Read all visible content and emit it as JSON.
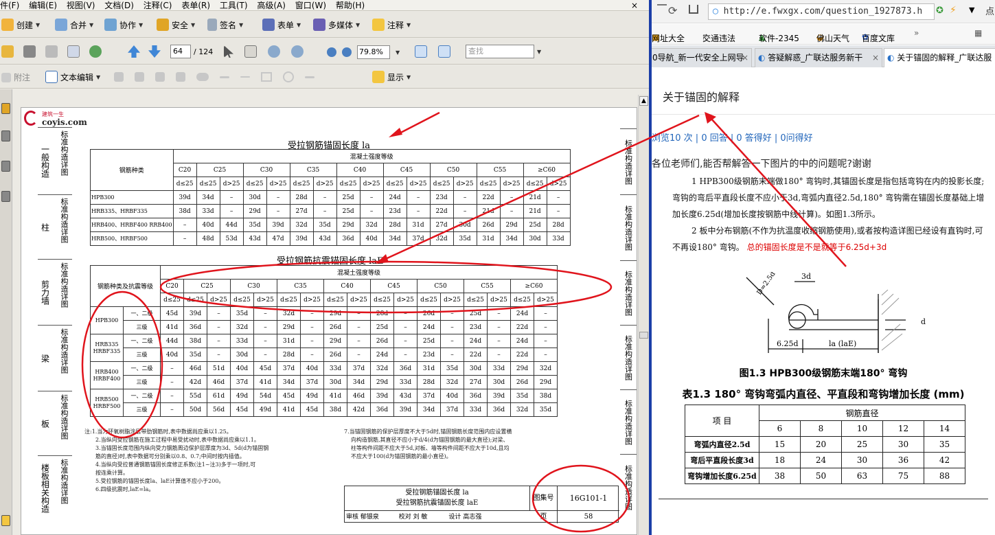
{
  "pdf_viewer": {
    "menu": [
      "件(F)",
      "编辑(E)",
      "视图(V)",
      "文档(D)",
      "注释(C)",
      "表单(R)",
      "工具(T)",
      "高级(A)",
      "窗口(W)",
      "帮助(H)"
    ],
    "close_glyph": "×",
    "toolbar1": {
      "create": "创建",
      "combine": "合并",
      "collaborate": "协作",
      "secure": "安全",
      "sign": "签名",
      "forms": "表单",
      "multimedia": "多媒体",
      "comment": "注释"
    },
    "toolbar2": {
      "page_current": "64",
      "page_total": "/ 124",
      "zoom": "79.8%",
      "find_placeholder": "查找"
    },
    "toolbar3": {
      "attach": "附注",
      "text_edit": "文本编辑",
      "show": "显示"
    },
    "document": {
      "logo_small": "建筑一生",
      "logo_text": "coyis.com",
      "left_categories": [
        {
          "big": "一般构造",
          "small": "标准构造详图"
        },
        {
          "big": "柱",
          "small": "标准构造详图"
        },
        {
          "big": "剪力墙",
          "small": "标准构造详图"
        },
        {
          "big": "梁",
          "small": "标准构造详图"
        },
        {
          "big": "板",
          "small": "标准构造详图"
        },
        {
          "big": "楼板相关构造",
          "small": "标准构造详图"
        }
      ],
      "right_category": "标准构造详图",
      "table1_title": "受拉钢筋锚固长度 la",
      "table2_title": "受拉钢筋抗震锚固长度 laE",
      "concrete_header": "混凝土强度等级",
      "grades": [
        "C20",
        "C25",
        "C30",
        "C35",
        "C40",
        "C45",
        "C50",
        "C55",
        "≥C60"
      ],
      "sub_le": "d≤25",
      "sub_gt": "d>25",
      "table1_col0": "钢筋种类",
      "table1_rows": [
        {
          "type": "HPB300",
          "vals": [
            "39d",
            "34d",
            "–",
            "30d",
            "–",
            "28d",
            "–",
            "25d",
            "–",
            "24d",
            "–",
            "23d",
            "–",
            "22d",
            "–",
            "21d",
            "–"
          ]
        },
        {
          "type": "HRB335、HRBF335",
          "vals": [
            "38d",
            "33d",
            "–",
            "29d",
            "–",
            "27d",
            "–",
            "25d",
            "–",
            "23d",
            "–",
            "22d",
            "–",
            "21d",
            "–",
            "21d",
            "–"
          ]
        },
        {
          "type": "HRB400、HRBF400 RRB400",
          "vals": [
            "–",
            "40d",
            "44d",
            "35d",
            "39d",
            "32d",
            "35d",
            "29d",
            "32d",
            "28d",
            "31d",
            "27d",
            "30d",
            "26d",
            "29d",
            "25d",
            "28d"
          ]
        },
        {
          "type": "HRB500、HRBF500",
          "vals": [
            "–",
            "48d",
            "53d",
            "43d",
            "47d",
            "39d",
            "43d",
            "36d",
            "40d",
            "34d",
            "37d",
            "32d",
            "35d",
            "31d",
            "34d",
            "30d",
            "33d"
          ]
        }
      ],
      "table2_col0": "钢筋种类及抗震等级",
      "table2_rows": [
        {
          "type": "HPB300",
          "grade": "一、二级",
          "vals": [
            "45d",
            "39d",
            "–",
            "35d",
            "–",
            "32d",
            "–",
            "29d",
            "–",
            "28d",
            "–",
            "26d",
            "–",
            "25d",
            "–",
            "24d",
            "–"
          ]
        },
        {
          "type": "",
          "grade": "三级",
          "vals": [
            "41d",
            "36d",
            "–",
            "32d",
            "–",
            "29d",
            "–",
            "26d",
            "–",
            "25d",
            "–",
            "24d",
            "–",
            "23d",
            "–",
            "22d",
            "–"
          ]
        },
        {
          "type": "HRB335 HRBF335",
          "grade": "一、二级",
          "vals": [
            "44d",
            "38d",
            "–",
            "33d",
            "–",
            "31d",
            "–",
            "29d",
            "–",
            "26d",
            "–",
            "25d",
            "–",
            "24d",
            "–",
            "24d",
            "–"
          ]
        },
        {
          "type": "",
          "grade": "三级",
          "vals": [
            "40d",
            "35d",
            "–",
            "30d",
            "–",
            "28d",
            "–",
            "26d",
            "–",
            "24d",
            "–",
            "23d",
            "–",
            "22d",
            "–",
            "22d",
            "–"
          ]
        },
        {
          "type": "HRB400 HRBF400",
          "grade": "一、二级",
          "vals": [
            "–",
            "46d",
            "51d",
            "40d",
            "45d",
            "37d",
            "40d",
            "33d",
            "37d",
            "32d",
            "36d",
            "31d",
            "35d",
            "30d",
            "33d",
            "29d",
            "32d"
          ]
        },
        {
          "type": "",
          "grade": "三级",
          "vals": [
            "–",
            "42d",
            "46d",
            "37d",
            "41d",
            "34d",
            "37d",
            "30d",
            "34d",
            "29d",
            "33d",
            "28d",
            "32d",
            "27d",
            "30d",
            "26d",
            "29d"
          ]
        },
        {
          "type": "HRB500 HRBF500",
          "grade": "一、二级",
          "vals": [
            "–",
            "55d",
            "61d",
            "49d",
            "54d",
            "45d",
            "49d",
            "41d",
            "46d",
            "39d",
            "43d",
            "37d",
            "40d",
            "36d",
            "39d",
            "35d",
            "38d"
          ]
        },
        {
          "type": "",
          "grade": "三级",
          "vals": [
            "–",
            "50d",
            "56d",
            "45d",
            "49d",
            "41d",
            "45d",
            "38d",
            "42d",
            "36d",
            "39d",
            "34d",
            "37d",
            "33d",
            "36d",
            "32d",
            "35d"
          ]
        }
      ],
      "notes_left": [
        "注:1.当为环氧树脂涂层带肋钢筋时,表中数据尚应乘以1.25。",
        "2.当纵向受拉钢筋在施工过程中易受扰动时,表中数据尚应乘以1.1。",
        "3.当锚固长度范围内纵向受力钢筋周边保护层厚度为3d、5d(d为锚固钢",
        "筋的直径)时,表中数据可分别乘以0.8、0.7;中间时按内插值。",
        "4.当纵向受拉普通钢筋锚固长度修正系数(注1~注3)多于一项时,可",
        "按连乘计算。",
        "5.受拉钢筋的锚固长度la、laE计算值不应小于200。",
        "6.四级抗震时,laE=la。"
      ],
      "notes_right": [
        "7.当锚固钢筋的保护层厚度不大于5d时,锚固钢筋长度范围内应设置横",
        "向构造钢筋,其直径不应小于d/4(d为锚固钢筋的最大直径);对梁、",
        "柱等构件间距不应大于5d,对板、墙等构件间距不应大于10d,且均",
        "不应大于100(d为锚固钢筋的最小直径)。"
      ],
      "title_block": {
        "title1": "受拉钢筋锚固长度 la",
        "title2": "受拉钢筋抗震锚固长度 laE",
        "atlas_label": "图集号",
        "atlas_no": "16G101-1",
        "page_label": "页",
        "page_no": "58",
        "review": "审核",
        "reviewer": "郁银泉",
        "check": "校对",
        "checker": "刘 敏",
        "design": "设计",
        "designer": "高志强"
      }
    }
  },
  "browser": {
    "url": "http://e.fwxgx.com/question_1927873.h",
    "bookmarks": [
      "网址大全",
      "交通违法",
      "软件-2345",
      "佛山天气",
      "百度文库"
    ],
    "bm_more": "»",
    "tabs": [
      {
        "label": "0导航_新一代安全上网导"
      },
      {
        "label": "答疑解惑_广联达服务新干"
      },
      {
        "label": "关于锚固的解释_广联达服"
      }
    ],
    "tab_close": "×",
    "question_title": "关于锚固的解释",
    "stats": "浏览10 次 | 0 回答 | 0 答得好 | 0问得好",
    "question_text": "各位老师们,能否帮解答一下图片的中的问题呢?谢谢",
    "scan_para1": "1 HPB300级钢筋末端做180° 弯钩时,其锚固长度是指包括弯钩在内的投影长度;弯钩的弯后平直段长度不应小于3d,弯弧内直径2.5d,180° 弯钩需在锚固长度基础上增加长度6.25d(增加长度按钢筋中线计算)。如图1.3所示。",
    "scan_para2": "2 板中分布钢筋(不作为抗温度收缩钢筋使用),或者按构造详图已经设有直钩时,可不再设180° 弯钩。",
    "red_question": "总的锚固长度是不是就等于6.25d+3d",
    "fig_labels": {
      "d1": "D=2.5d",
      "d2": "3d",
      "d3": "6.25d",
      "d4": "la (laE)",
      "d5": "d"
    },
    "fig_caption": "图1.3  HPB300级钢筋末端180° 弯钩",
    "table_caption": "表1.3  180° 弯钩弯弧内直径、平直段和弯钩增加长度 (mm)",
    "table": {
      "col0": "项  目",
      "group": "钢筋直径",
      "diams": [
        "6",
        "8",
        "10",
        "12",
        "14"
      ],
      "rows": [
        {
          "label": "弯弧内直径2.5d",
          "vals": [
            "15",
            "20",
            "25",
            "30",
            "35"
          ]
        },
        {
          "label": "弯后平直段长度3d",
          "vals": [
            "18",
            "24",
            "30",
            "36",
            "42"
          ]
        },
        {
          "label": "弯钩增加长度6.25d",
          "vals": [
            "38",
            "50",
            "63",
            "75",
            "88"
          ]
        }
      ]
    }
  }
}
